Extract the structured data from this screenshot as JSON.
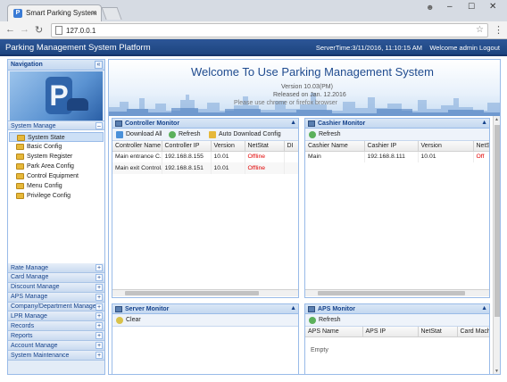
{
  "browser": {
    "tab_title": "Smart Parking System",
    "tab_favicon": "P",
    "tab_close": "×",
    "url": "127.0.0.1",
    "window_user": "☻",
    "window_minimize": "–",
    "window_maximize": "☐",
    "window_close": "✕",
    "back": "←",
    "forward": "→",
    "reload": "↻",
    "star": "☆",
    "menu": "⋮"
  },
  "app": {
    "title": "Parking Management System Platform",
    "server_time": "ServerTime:3/11/2016, 11:10:15 AM",
    "welcome_user": "Welcome admin",
    "logout": "Logout"
  },
  "nav": {
    "title": "Navigation",
    "collapse": "«",
    "banner_letter": "P",
    "open_group": {
      "label": "System Manage",
      "toggle": "–",
      "items": [
        {
          "label": "System State",
          "active": true
        },
        {
          "label": "Basic Config"
        },
        {
          "label": "System Register"
        },
        {
          "label": "Park Area Config"
        },
        {
          "label": "Control Equipment"
        },
        {
          "label": "Menu Config"
        },
        {
          "label": "Privilege Config"
        }
      ]
    },
    "groups": [
      {
        "label": "Rate Manage",
        "toggle": "+"
      },
      {
        "label": "Card Manage",
        "toggle": "+"
      },
      {
        "label": "Discount Manage",
        "toggle": "+"
      },
      {
        "label": "APS Manage",
        "toggle": "+"
      },
      {
        "label": "Company/Department Manage",
        "toggle": "+"
      },
      {
        "label": "LPR Manage",
        "toggle": "+"
      },
      {
        "label": "Records",
        "toggle": "+"
      },
      {
        "label": "Reports",
        "toggle": "+"
      },
      {
        "label": "Account Manage",
        "toggle": "+"
      },
      {
        "label": "System Maintenance",
        "toggle": "+"
      }
    ]
  },
  "banner": {
    "welcome": "Welcome To Use Parking Management System",
    "version": "Version 10.03(PM)",
    "released": "Released on Jan. 12.2016",
    "recommend": "Please use chrome or firefox browser"
  },
  "controller_monitor": {
    "title": "Controller Monitor",
    "collapse": "▲",
    "toolbar": {
      "download_all": "Download All",
      "refresh": "Refresh",
      "auto_download": "Auto Download Config"
    },
    "columns": [
      "Controller Name",
      "Controller IP",
      "Version",
      "NetStat",
      "DI"
    ],
    "rows": [
      [
        "Main entrance C...",
        "192.168.8.155",
        "10.01",
        "Offline",
        ""
      ],
      [
        "Main exit Control...",
        "192.168.8.151",
        "10.01",
        "Offline",
        ""
      ]
    ]
  },
  "cashier_monitor": {
    "title": "Cashier Monitor",
    "collapse": "▲",
    "toolbar": {
      "refresh": "Refresh"
    },
    "columns": [
      "Cashier Name",
      "Cashier IP",
      "Version",
      "NetSt"
    ],
    "rows": [
      [
        "Main",
        "192.168.8.111",
        "10.01",
        "Off"
      ]
    ]
  },
  "server_monitor": {
    "title": "Server Monitor",
    "collapse": "▲",
    "toolbar": {
      "clear": "Clear"
    }
  },
  "aps_monitor": {
    "title": "APS Monitor",
    "collapse": "▲",
    "toolbar": {
      "refresh": "Refresh"
    },
    "columns": [
      "APS Name",
      "APS IP",
      "NetStat",
      "Card Mach"
    ],
    "empty": "Empty"
  },
  "colors": {
    "header_blue": "#1d447f",
    "panel_border": "#99bbe8",
    "offline_red": "#e00000"
  },
  "scroll": {
    "up": "▲",
    "down": "▼"
  }
}
